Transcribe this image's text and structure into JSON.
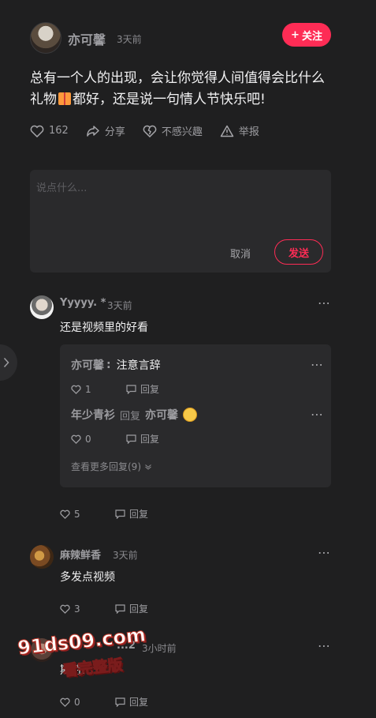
{
  "post": {
    "author": "亦可馨",
    "time": "3天前",
    "follow_label": "关注",
    "text_part1": "总有一个人的出现，会让你觉得人间值得会比什么礼物",
    "text_part2": "都好，还是说一句情人节快乐吧!",
    "likes": "162",
    "share_label": "分享",
    "not_interested_label": "不感兴趣",
    "report_label": "举报"
  },
  "comment_box": {
    "placeholder": "说点什么...",
    "cancel_label": "取消",
    "send_label": "发送"
  },
  "comments": [
    {
      "name": "Yyyyy. *",
      "time": "3天前",
      "text": "还是视频里的好看",
      "likes": "5",
      "reply_label": "回复",
      "replies": [
        {
          "author": "亦可馨",
          "separator": ":",
          "text": "注意言辞",
          "likes": "1",
          "reply_label": "回复"
        },
        {
          "author": "年少青衫",
          "reply_word": "回复",
          "target": "亦可馨",
          "likes": "0",
          "reply_label": "回复"
        }
      ],
      "see_more": "查看更多回复(9)"
    },
    {
      "name": "麻辣鲜香",
      "time": "3天前",
      "text": "多发点视频",
      "likes": "3",
      "reply_label": "回复"
    },
    {
      "name": "...2",
      "time": "3小时前",
      "text": "期待...",
      "likes": "0",
      "reply_label": "回复"
    }
  ],
  "watermark": {
    "url": "91ds09.com",
    "subtitle": "看完整版"
  },
  "colors": {
    "background": "#1f1f20",
    "accent": "#fe2c55",
    "card": "#2a2a2c"
  }
}
